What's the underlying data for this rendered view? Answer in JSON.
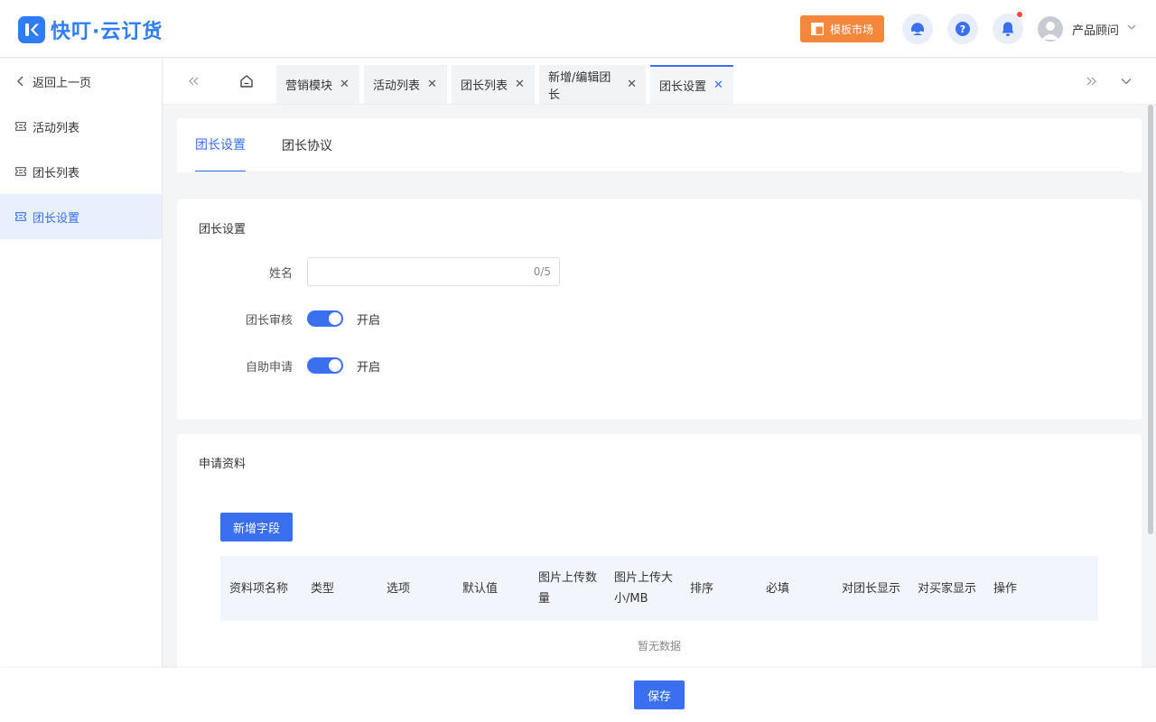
{
  "app": {
    "logo_text": "快叮·云订货"
  },
  "header": {
    "market_label": "模板市场",
    "user_name": "产品顾问",
    "icons": [
      "service-icon",
      "help-icon",
      "bell-icon"
    ]
  },
  "sidebar": {
    "back_label": "返回上一页",
    "items": [
      {
        "label": "活动列表"
      },
      {
        "label": "团长列表"
      },
      {
        "label": "团长设置"
      }
    ]
  },
  "tabs": [
    {
      "label": "营销模块"
    },
    {
      "label": "活动列表"
    },
    {
      "label": "团长列表"
    },
    {
      "label": "新增/编辑团长"
    },
    {
      "label": "团长设置"
    }
  ],
  "subtabs": [
    {
      "label": "团长设置"
    },
    {
      "label": "团长协议"
    }
  ],
  "settings": {
    "title": "团长设置",
    "name_label": "姓名",
    "name_value": "",
    "name_count": "0/5",
    "review_label": "团长审核",
    "review_state": "开启",
    "self_apply_label": "自助申请",
    "self_apply_state": "开启"
  },
  "apply": {
    "title": "申请资料",
    "add_button": "新增字段",
    "columns": [
      "资料项名称",
      "类型",
      "选项",
      "默认值",
      "图片上传数量",
      "图片上传大小/MB",
      "排序",
      "必填",
      "对团长显示",
      "对买家显示",
      "操作"
    ],
    "empty_text": "暂无数据"
  },
  "footer": {
    "save_label": "保存"
  },
  "colors": {
    "primary": "#3a6ff0",
    "brand": "#2f7cf6",
    "market": "#f5873c"
  }
}
